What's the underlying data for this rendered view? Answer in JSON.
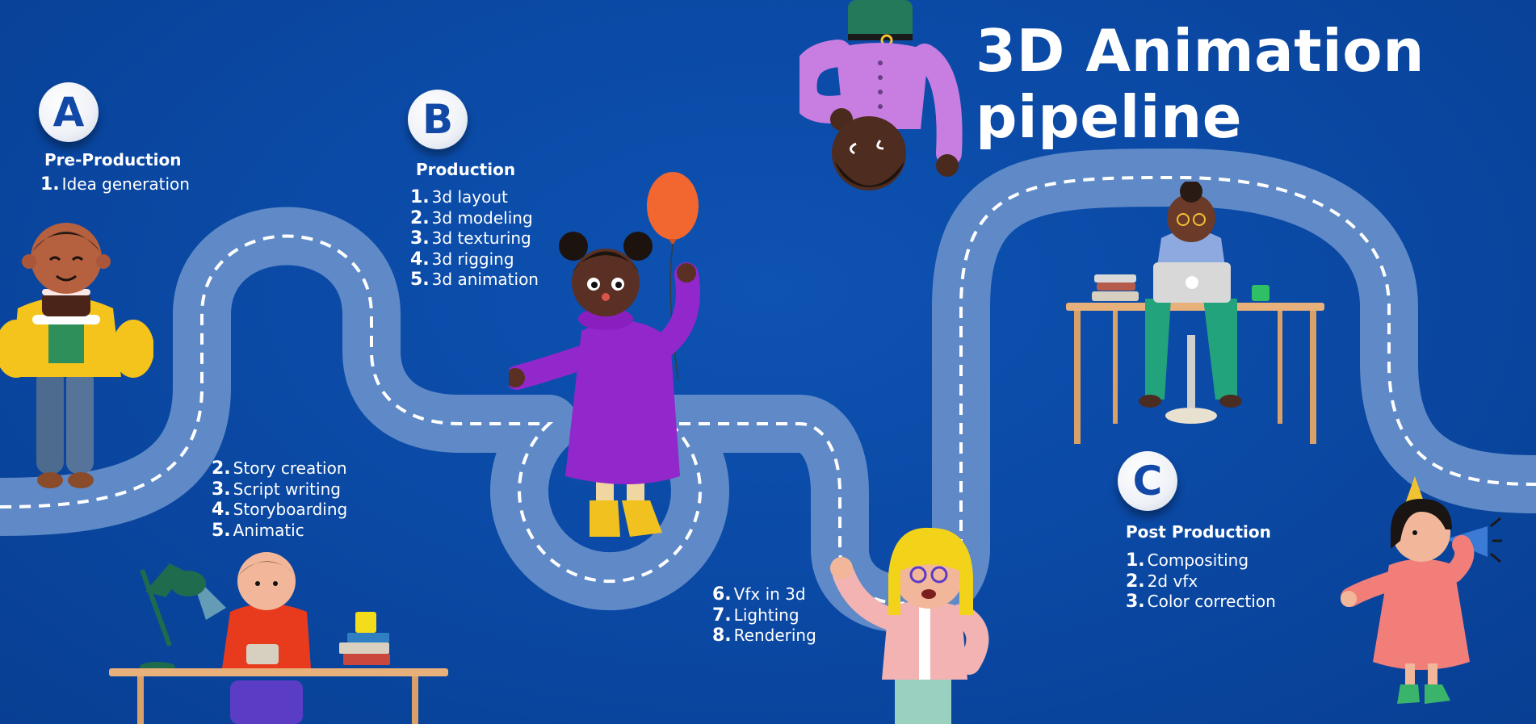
{
  "title": {
    "line1": "3D Animation",
    "line2": "pipeline"
  },
  "stages": [
    {
      "badge": "A",
      "heading": "Pre-Production",
      "steps": [
        {
          "num": "1.",
          "text": "Idea generation"
        }
      ],
      "steps_more": [
        {
          "num": "2.",
          "text": "Story creation"
        },
        {
          "num": "3.",
          "text": "Script writing"
        },
        {
          "num": "4.",
          "text": "Storyboarding"
        },
        {
          "num": "5.",
          "text": "Animatic"
        }
      ]
    },
    {
      "badge": "B",
      "heading": "Production",
      "steps": [
        {
          "num": "1.",
          "text": "3d layout"
        },
        {
          "num": "2.",
          "text": "3d modeling"
        },
        {
          "num": "3.",
          "text": "3d texturing"
        },
        {
          "num": "4.",
          "text": "3d rigging"
        },
        {
          "num": "5.",
          "text": "3d animation"
        }
      ],
      "steps_more": [
        {
          "num": "6.",
          "text": "Vfx in 3d"
        },
        {
          "num": "7.",
          "text": "Lighting"
        },
        {
          "num": "8.",
          "text": "Rendering"
        }
      ]
    },
    {
      "badge": "C",
      "heading": "Post Production",
      "steps": [
        {
          "num": "1.",
          "text": "Compositing"
        },
        {
          "num": "2.",
          "text": "2d vfx"
        },
        {
          "num": "3.",
          "text": "Color correction"
        }
      ]
    }
  ],
  "illustrations": [
    "boy-with-cake",
    "girl-with-balloon",
    "upside-down-boy",
    "woman-at-laptop-desk",
    "boy-at-desk-with-lamp",
    "waving-blonde-woman",
    "girl-with-party-horn"
  ],
  "colors": {
    "background": "#0a4aa6",
    "road": "#5f8ac7",
    "road_dashes": "#ffffff",
    "text": "#ffffff",
    "badge_letter": "#1249a6"
  }
}
